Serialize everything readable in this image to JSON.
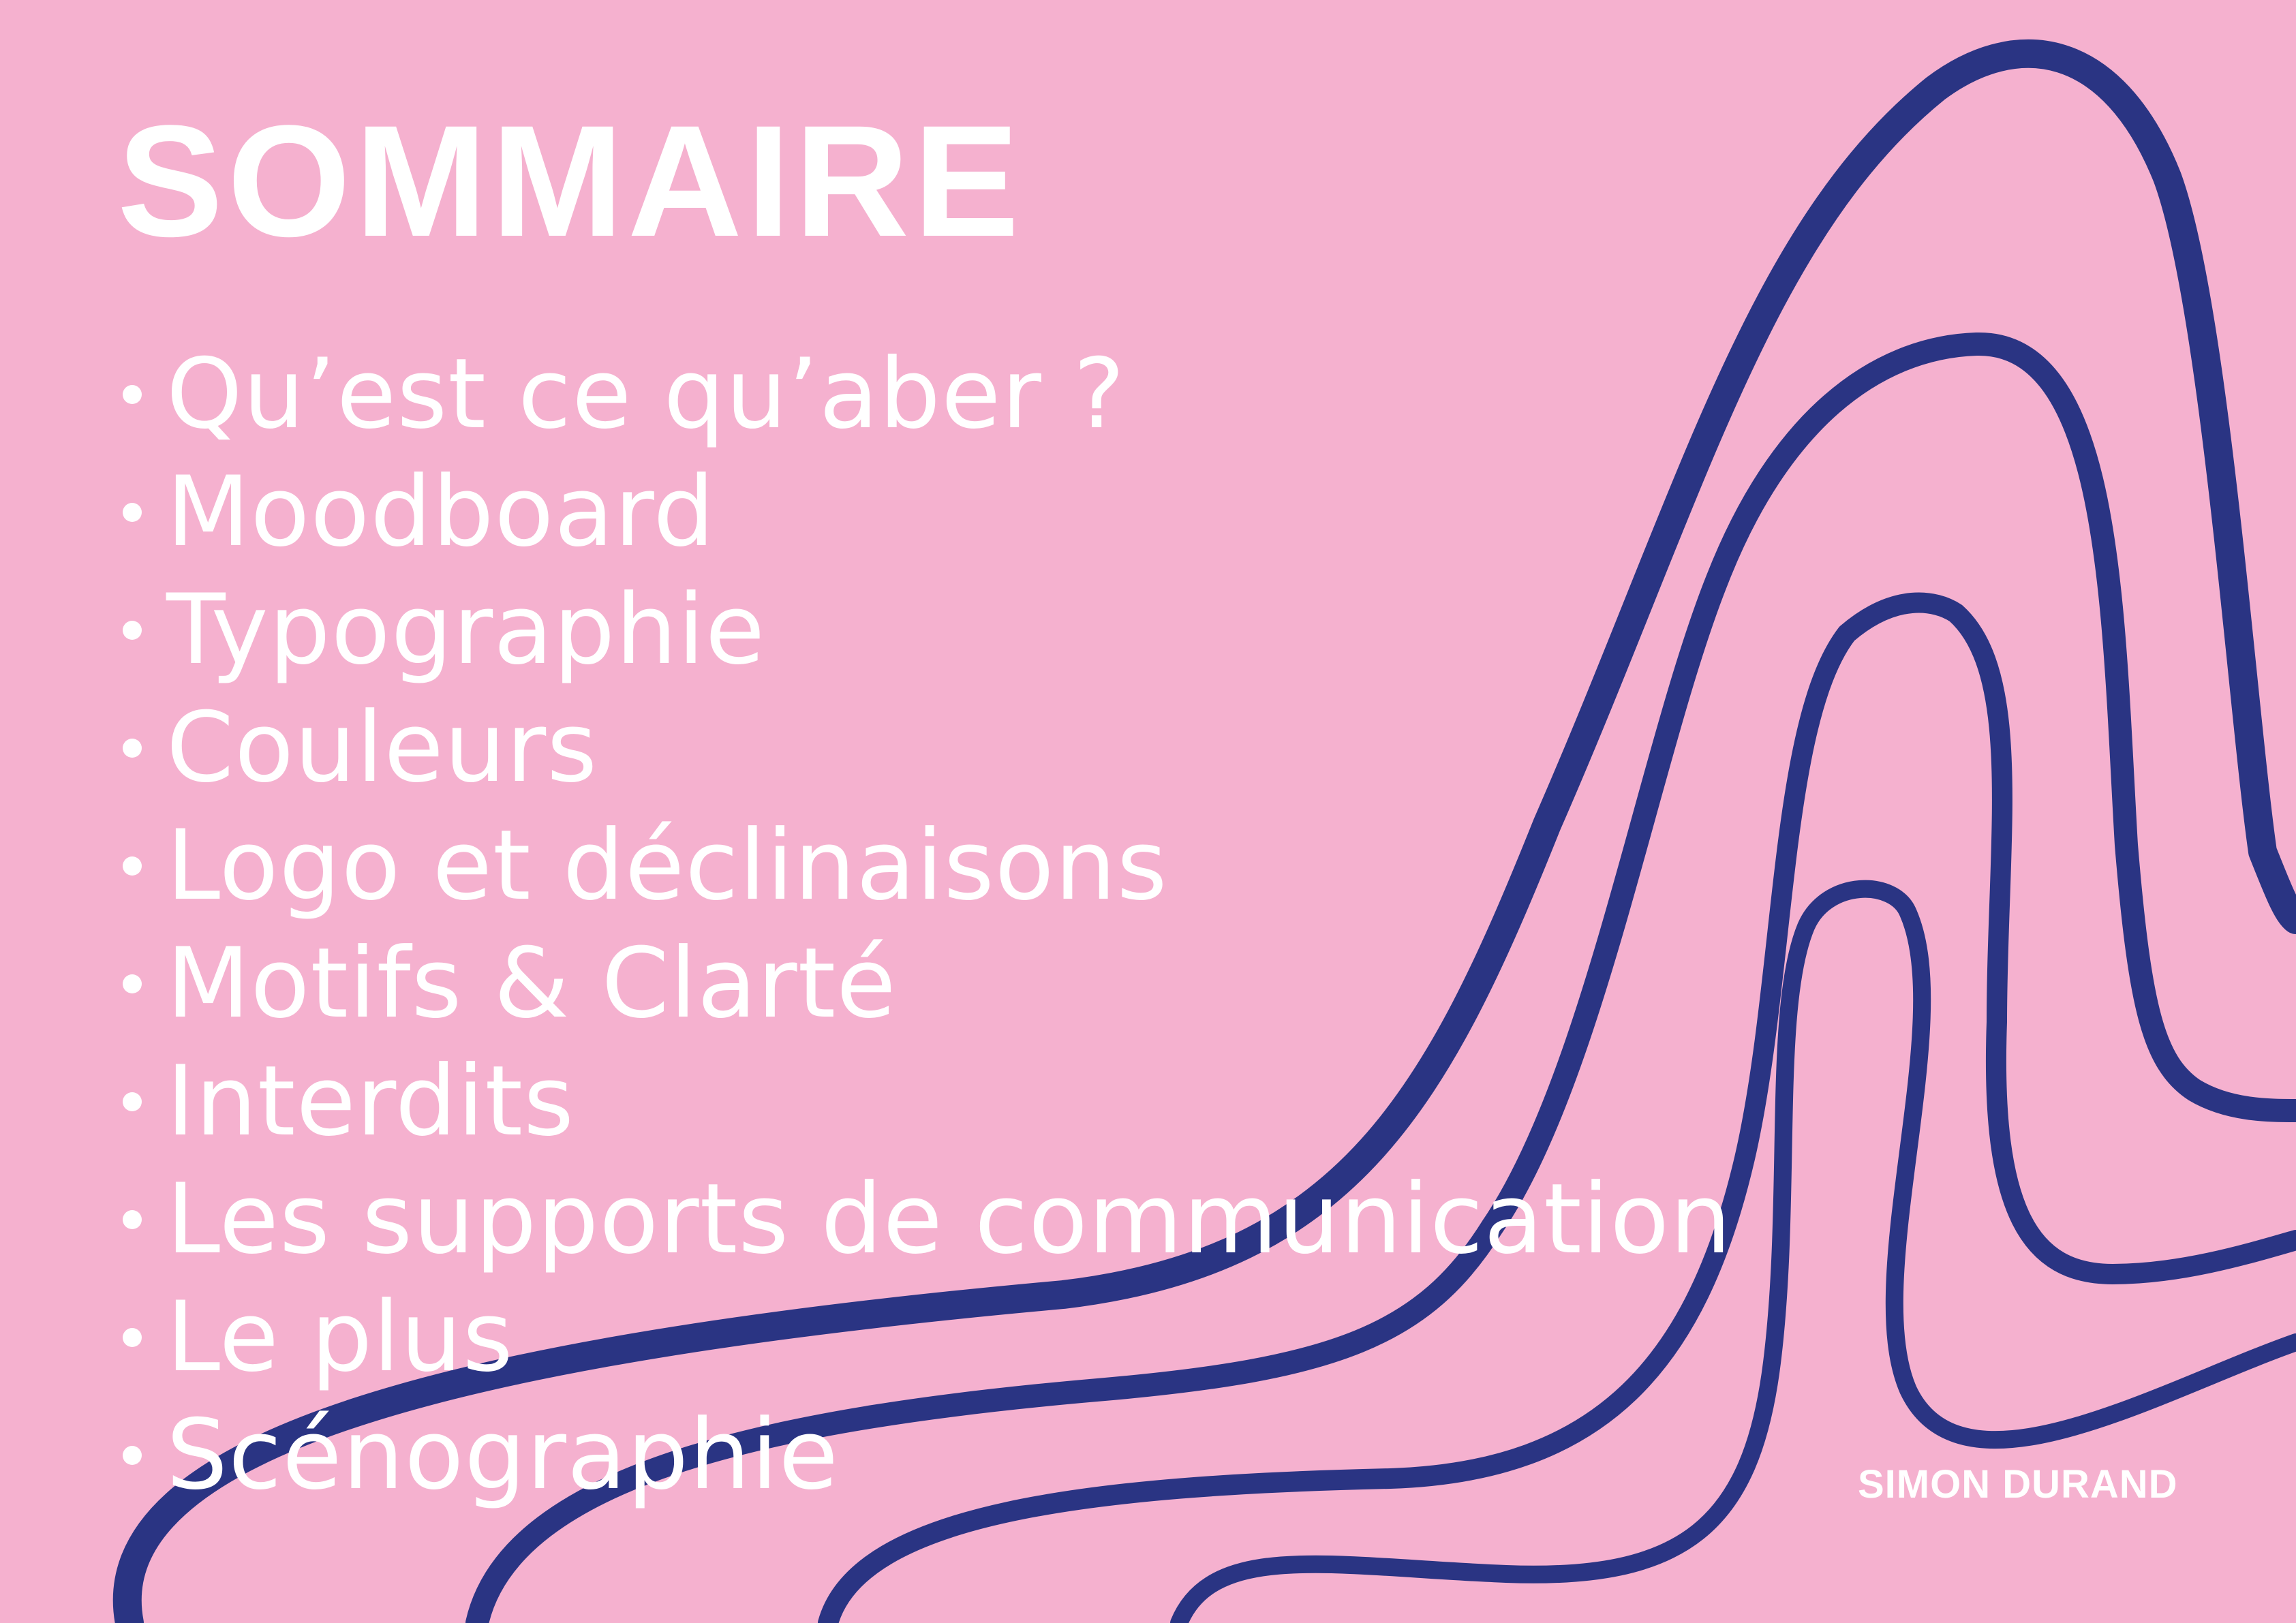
{
  "document": {
    "title": "SOMMAIRE",
    "brand": "SIMON DURAND",
    "colors": {
      "background": "#f5b1cf",
      "text": "#ffffff",
      "wave": "#2a3483"
    },
    "toc": [
      {
        "label": "Qu’est ce qu’aber ?"
      },
      {
        "label": "Moodboard"
      },
      {
        "label": "Typographie"
      },
      {
        "label": "Couleurs"
      },
      {
        "label": "Logo et déclinaisons"
      },
      {
        "label": "Motifs & Clarté"
      },
      {
        "label": "Interdits"
      },
      {
        "label": "Les supports de communication"
      },
      {
        "label": "Le plus"
      },
      {
        "label": "Scénographie"
      }
    ]
  }
}
